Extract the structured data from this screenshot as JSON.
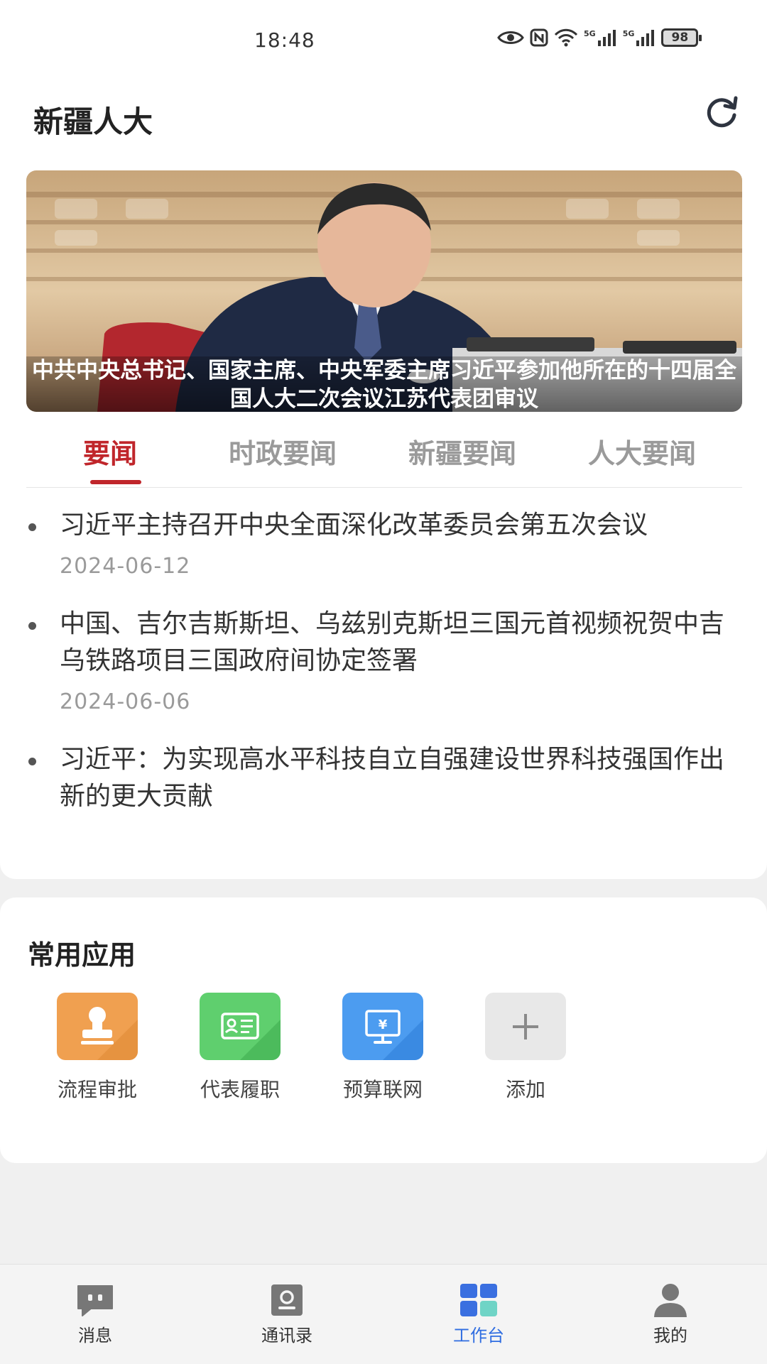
{
  "status_bar": {
    "time": "18:48",
    "network_1": "5G",
    "network_2": "5G",
    "battery": "98",
    "icons": [
      "eye-icon",
      "nfc-icon",
      "wifi-icon",
      "signal-icon",
      "signal-icon",
      "battery-icon"
    ]
  },
  "header": {
    "title": "新疆人大",
    "refresh_icon": "refresh-icon"
  },
  "banner": {
    "caption": "中共中央总书记、国家主席、中央军委主席习近平参加他所在的十四届全国人大二次会议江苏代表团审议"
  },
  "tabs": [
    {
      "label": "要闻",
      "active": true
    },
    {
      "label": "时政要闻",
      "active": false
    },
    {
      "label": "新疆要闻",
      "active": false
    },
    {
      "label": "人大要闻",
      "active": false
    }
  ],
  "news": [
    {
      "title": "习近平主持召开中央全面深化改革委员会第五次会议",
      "date": "2024-06-12"
    },
    {
      "title": "中国、吉尔吉斯斯坦、乌兹别克斯坦三国元首视频祝贺中吉乌铁路项目三国政府间协定签署",
      "date": "2024-06-06"
    },
    {
      "title": "习近平：为实现高水平科技自立自强建设世界科技强国作出新的更大贡献",
      "date": ""
    }
  ],
  "apps": {
    "title": "常用应用",
    "items": [
      {
        "label": "流程审批",
        "icon": "stamp-icon",
        "color": "#f0a050"
      },
      {
        "label": "代表履职",
        "icon": "id-card-icon",
        "color": "#5fcf6e"
      },
      {
        "label": "预算联网",
        "icon": "monitor-yuan-icon",
        "color": "#4c9cf0"
      },
      {
        "label": "添加",
        "icon": "plus-icon",
        "color": "#e8e8e8"
      }
    ]
  },
  "bottom_nav": [
    {
      "label": "消息",
      "icon": "message-icon",
      "active": false
    },
    {
      "label": "通讯录",
      "icon": "contacts-icon",
      "active": false
    },
    {
      "label": "工作台",
      "icon": "workbench-icon",
      "active": true
    },
    {
      "label": "我的",
      "icon": "profile-icon",
      "active": false
    }
  ],
  "colors": {
    "accent_red": "#c0262b",
    "nav_active_blue": "#2f6de1"
  }
}
